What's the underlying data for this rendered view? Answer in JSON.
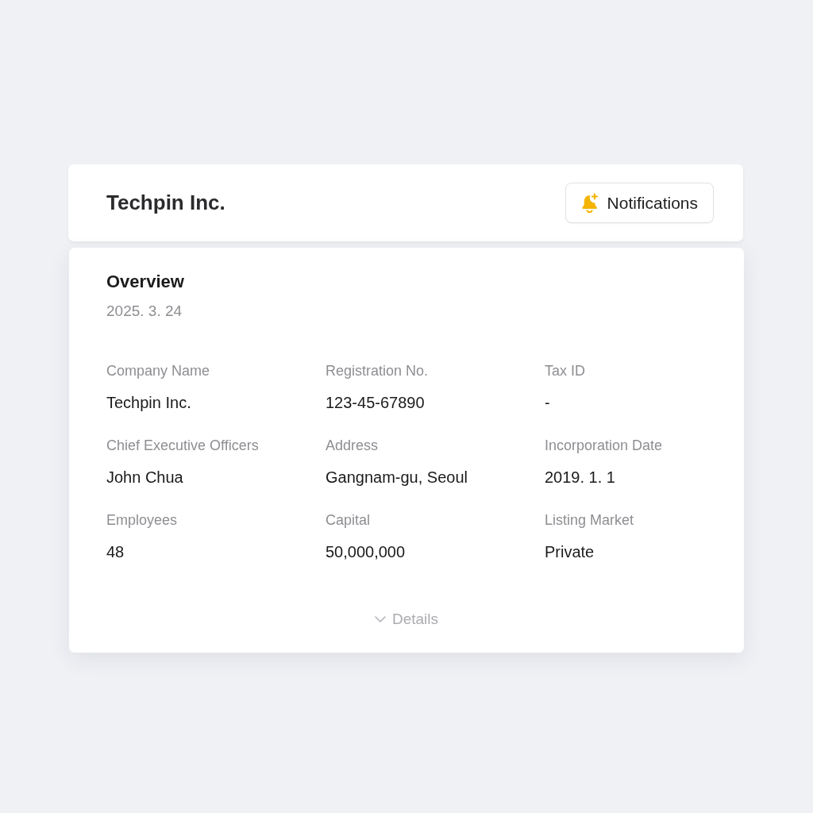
{
  "header": {
    "title": "Techpin Inc.",
    "notifications_button": {
      "label": "Notifications"
    }
  },
  "overview": {
    "title": "Overview",
    "date": "2025. 3. 24",
    "fields": [
      {
        "label": "Company Name",
        "value": "Techpin Inc."
      },
      {
        "label": "Registration No.",
        "value": "123-45-67890"
      },
      {
        "label": "Tax ID",
        "value": "-"
      },
      {
        "label": "Chief Executive Officers",
        "value": "John Chua"
      },
      {
        "label": "Address",
        "value": "Gangnam-gu, Seoul"
      },
      {
        "label": "Incorporation Date",
        "value": "2019. 1. 1"
      },
      {
        "label": "Employees",
        "value": "48"
      },
      {
        "label": "Capital",
        "value": "50,000,000"
      },
      {
        "label": "Listing Market",
        "value": "Private"
      }
    ],
    "details_toggle": {
      "label": "Details",
      "expanded": false
    }
  }
}
